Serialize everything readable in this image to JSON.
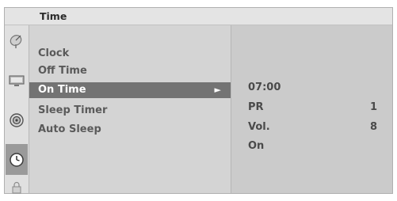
{
  "header": {
    "title": "Time"
  },
  "icons": [
    {
      "name": "satellite-dish-icon",
      "selected": false
    },
    {
      "name": "monitor-icon",
      "selected": false
    },
    {
      "name": "speaker-icon",
      "selected": false
    },
    {
      "name": "clock-icon",
      "selected": true
    },
    {
      "name": "lock-icon",
      "selected": false
    }
  ],
  "menu": {
    "items": [
      {
        "label": "Clock"
      },
      {
        "label": "Off Time"
      },
      {
        "label": "On Time",
        "selected": true,
        "arrow": "►"
      },
      {
        "label": "Sleep Timer"
      },
      {
        "label": "Auto Sleep"
      }
    ]
  },
  "on_time": {
    "time": "07:00",
    "pr_label": "PR",
    "pr_value": "1",
    "vol_label": "Vol.",
    "vol_value": "8",
    "state": "On"
  }
}
